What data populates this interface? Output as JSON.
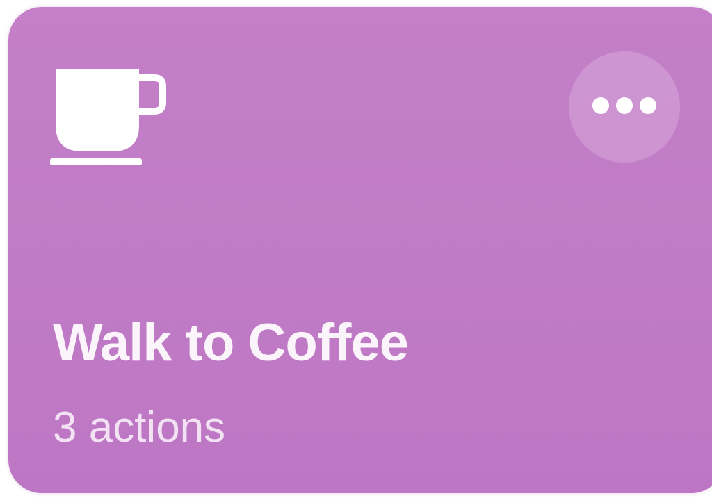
{
  "shortcut": {
    "title": "Walk to Coffee",
    "subtitle": "3 actions",
    "icon": "coffee-cup-icon",
    "more_icon": "ellipsis-icon",
    "background_color": "#c27dc7"
  }
}
